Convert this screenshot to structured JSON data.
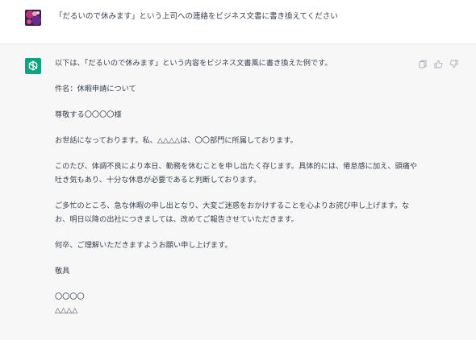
{
  "user": {
    "message": "「だるいので休みます」という上司への連絡をビジネス文書に書き換えてください"
  },
  "assistant": {
    "paragraphs": [
      "以下は、「だるいので休みます」という内容をビジネス文書風に書き換えた例です。",
      "件名：休暇申請について",
      "尊敬する〇〇〇〇様",
      "お世話になっております。私、△△△△は、〇〇部門に所属しております。",
      "このたび、体調不良により本日、勤務を休むことを申し出たく存じます。具体的には、倦怠感に加え、頭痛や吐き気もあり、十分な休息が必要であると判断しております。",
      "ご多忙のところ、急な休暇の申し出となり、大変ご迷惑をおかけすることを心よりお詫び申し上げます。なお、明日以降の出社につきましては、改めてご報告させていただきます。",
      "何卒、ご理解いただきますようお願い申し上げます。",
      "敬具"
    ],
    "signature": [
      "〇〇〇〇",
      "△△△△"
    ]
  },
  "actions": {
    "icons": [
      "copy-icon",
      "thumbs-up-icon",
      "thumbs-down-icon"
    ]
  },
  "colors": {
    "assistant_bg": "#f7f7f8",
    "bot_avatar": "#10a37f",
    "text": "#374151",
    "icon": "#acacbe"
  }
}
